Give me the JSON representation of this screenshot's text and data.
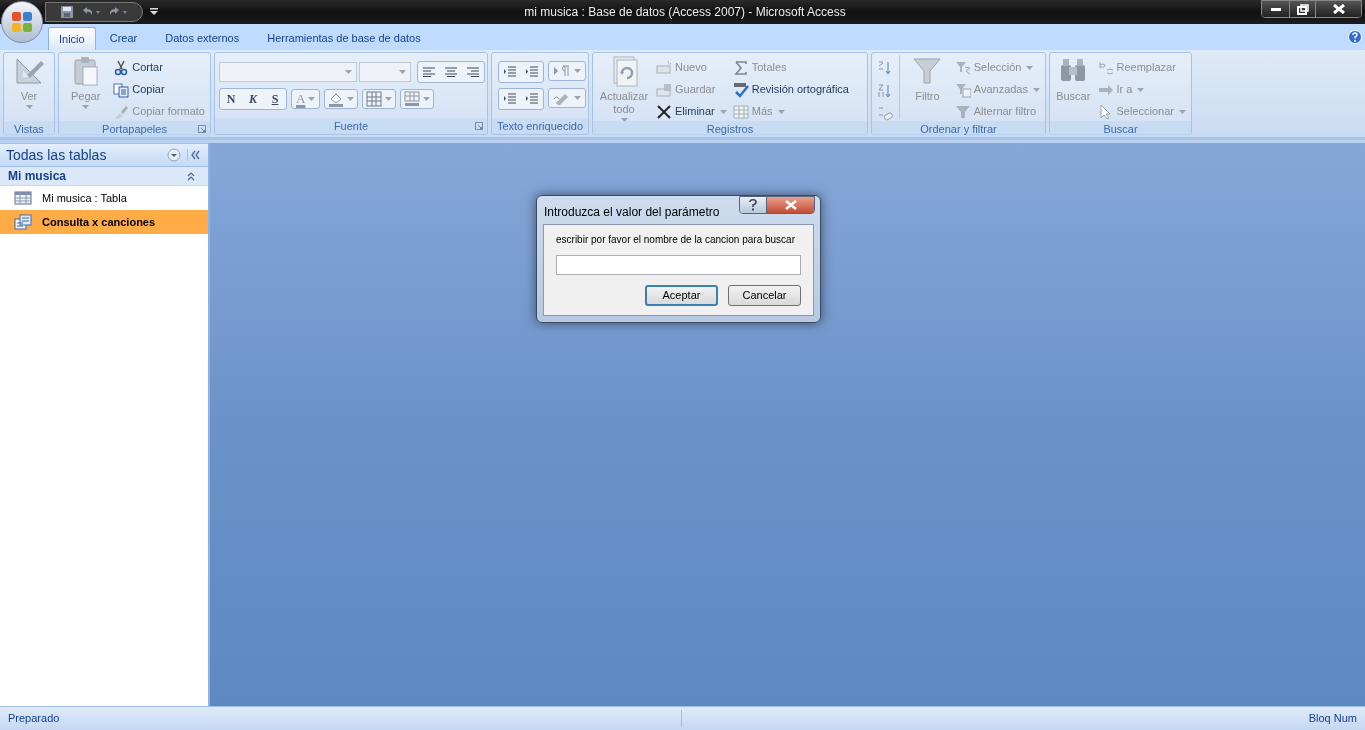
{
  "window": {
    "title": "mi musica : Base de datos (Access 2007)  -  Microsoft Access"
  },
  "tabs": [
    {
      "label": "Inicio",
      "selected": true
    },
    {
      "label": "Crear",
      "selected": false
    },
    {
      "label": "Datos externos",
      "selected": false
    },
    {
      "label": "Herramientas de base de datos",
      "selected": false
    }
  ],
  "ribbon": {
    "groups": [
      {
        "label": "Vistas",
        "kind": "commands",
        "launcher": false,
        "columns": [
          {
            "kind": "large",
            "label": "Ver",
            "disabled": true,
            "menu": true
          }
        ]
      },
      {
        "label": "Portapapeles",
        "kind": "commands",
        "launcher": true,
        "columns": [
          {
            "kind": "large",
            "label": "Pegar",
            "disabled": true,
            "menu": true
          },
          {
            "kind": "stack",
            "items": [
              {
                "label": "Cortar",
                "disabled": false,
                "menu": false
              },
              {
                "label": "Copiar",
                "disabled": false,
                "menu": false
              },
              {
                "label": "Copiar formato",
                "disabled": true,
                "menu": false
              }
            ]
          }
        ]
      },
      {
        "label": "Fuente",
        "kind": "font",
        "launcher": true,
        "format_buttons": [
          "N",
          "K",
          "S"
        ],
        "font_color": "A"
      },
      {
        "label": "Texto enriquecido",
        "kind": "richtext",
        "launcher": false
      },
      {
        "label": "Registros",
        "kind": "commands",
        "launcher": false,
        "columns": [
          {
            "kind": "large",
            "label": "Actualizar todo",
            "disabled": true,
            "menu": true
          },
          {
            "kind": "stack",
            "items": [
              {
                "label": "Nuevo",
                "disabled": true,
                "menu": false
              },
              {
                "label": "Guardar",
                "disabled": true,
                "menu": false
              },
              {
                "label": "Eliminar",
                "disabled": false,
                "menu": true
              }
            ]
          },
          {
            "kind": "stack",
            "items": [
              {
                "label": "Totales",
                "disabled": true,
                "menu": false
              },
              {
                "label": "Revisión ortográfica",
                "disabled": false,
                "menu": false
              },
              {
                "label": "Más",
                "disabled": true,
                "menu": true
              }
            ]
          }
        ]
      },
      {
        "label": "Ordenar y filtrar",
        "kind": "commands",
        "launcher": false,
        "columns": [
          {
            "kind": "sort"
          },
          {
            "kind": "large",
            "label": "Filtro",
            "disabled": true,
            "menu": false
          },
          {
            "kind": "stack",
            "items": [
              {
                "label": "Selección",
                "disabled": true,
                "menu": true
              },
              {
                "label": "Avanzadas",
                "disabled": true,
                "menu": true
              },
              {
                "label": "Alternar filtro",
                "disabled": true,
                "menu": false
              }
            ]
          }
        ]
      },
      {
        "label": "Buscar",
        "kind": "commands",
        "launcher": false,
        "columns": [
          {
            "kind": "large",
            "label": "Buscar",
            "disabled": true,
            "menu": false
          },
          {
            "kind": "stack",
            "items": [
              {
                "label": "Reemplazar",
                "disabled": true,
                "menu": false
              },
              {
                "label": "Ir a",
                "disabled": true,
                "menu": true
              },
              {
                "label": "Seleccionar",
                "disabled": true,
                "menu": true
              }
            ]
          }
        ]
      }
    ]
  },
  "nav_pane": {
    "title": "Todas las tablas",
    "groups": [
      {
        "label": "Mi musica",
        "expanded": true,
        "items": [
          {
            "label": "Mi musica : Tabla",
            "kind": "table",
            "selected": false
          },
          {
            "label": "Consulta x canciones",
            "kind": "query",
            "selected": true
          }
        ]
      }
    ]
  },
  "dialog": {
    "title": "Introduzca el valor del parámetro",
    "prompt": "escribir por favor el nombre de la cancion para buscar",
    "buttons": [
      {
        "label": "Aceptar",
        "default": true
      },
      {
        "label": "Cancelar",
        "default": false
      }
    ]
  },
  "status_bar": {
    "left": "Preparado",
    "right": "Bloq Num"
  }
}
